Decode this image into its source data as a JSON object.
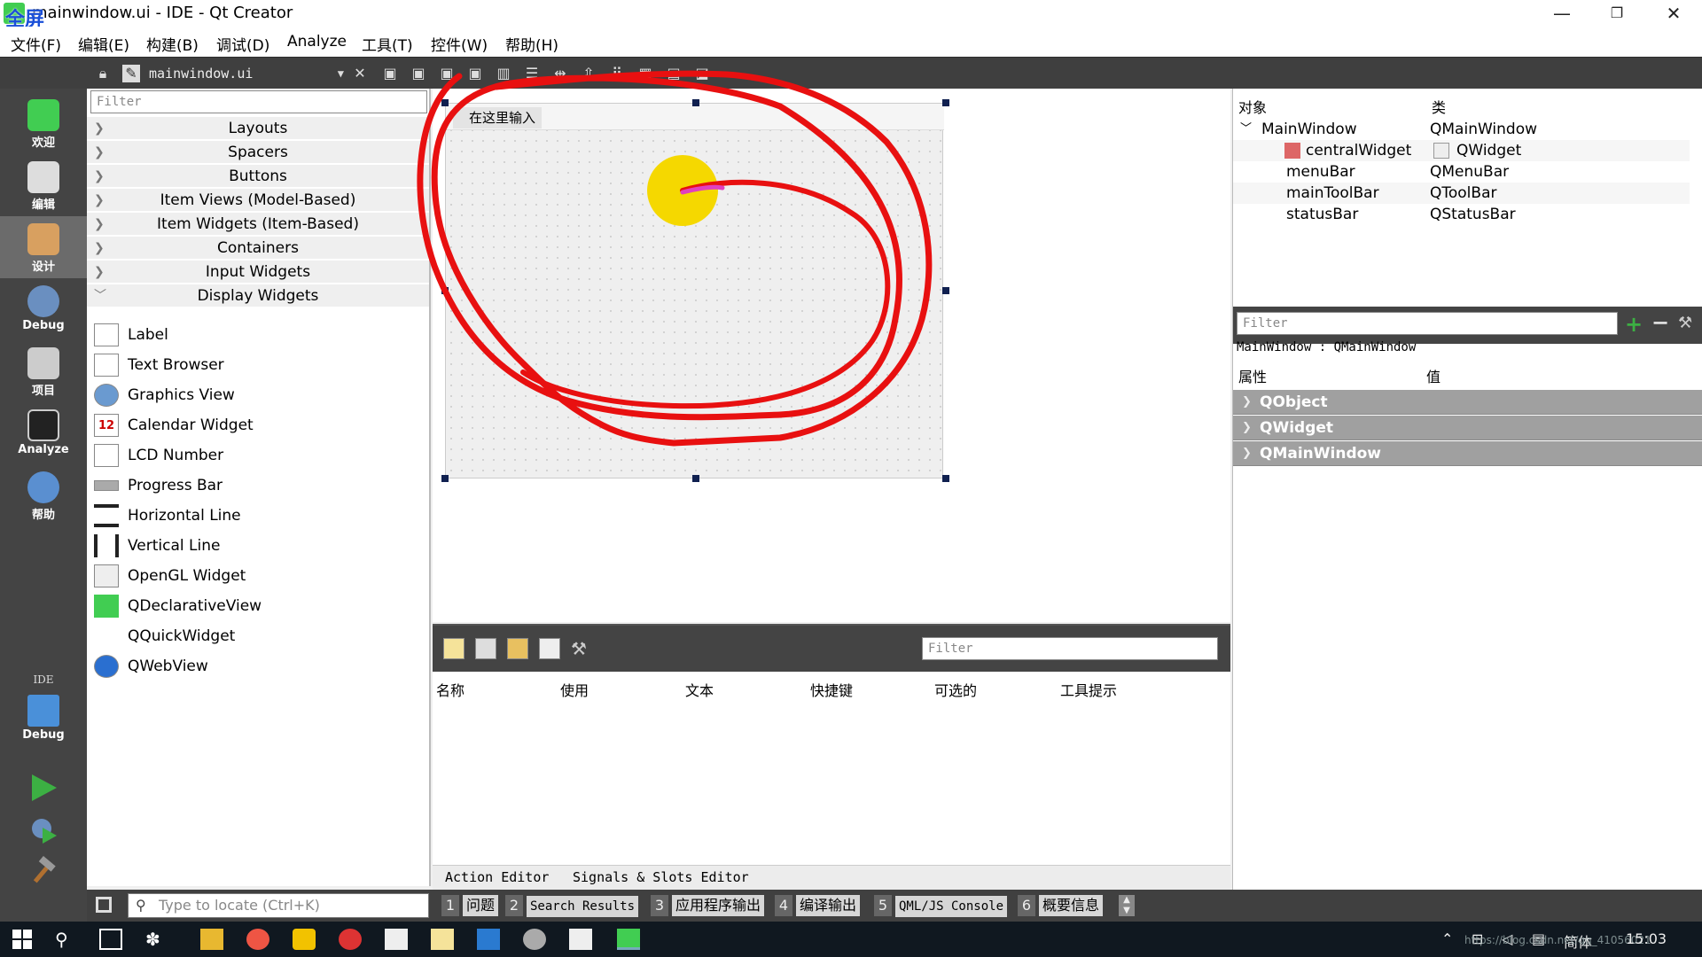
{
  "window": {
    "title": "mainwindow.ui - IDE - Qt Creator",
    "fullscreen_label": "全屏",
    "minimize": "—",
    "restore": "❐",
    "close": "✕"
  },
  "menubar": [
    "文件(F)",
    "编辑(E)",
    "构建(B)",
    "调试(D)",
    "Analyze",
    "工具(T)",
    "控件(W)",
    "帮助(H)"
  ],
  "toolbar": {
    "open_document": "mainwindow.ui"
  },
  "modes": [
    {
      "label": "欢迎",
      "color": "#41cd52"
    },
    {
      "label": "编辑",
      "color": "#dddddd"
    },
    {
      "label": "设计",
      "color": "#d8a060"
    },
    {
      "label": "Debug",
      "color": "#6a8fc0"
    },
    {
      "label": "项目",
      "color": "#cccccc"
    },
    {
      "label": "Analyze",
      "color": "#222222"
    },
    {
      "label": "帮助",
      "color": "#5a8fd0"
    }
  ],
  "kit_selector": {
    "label": "IDE",
    "mode": "Debug"
  },
  "widgetbox": {
    "filter_placeholder": "Filter",
    "categories": [
      "Layouts",
      "Spacers",
      "Buttons",
      "Item Views (Model-Based)",
      "Item Widgets (Item-Based)",
      "Containers",
      "Input Widgets",
      "Display Widgets"
    ],
    "display_widgets": [
      "Label",
      "Text Browser",
      "Graphics View",
      "Calendar Widget",
      "LCD Number",
      "Progress Bar",
      "Horizontal Line",
      "Vertical Line",
      "OpenGL Widget",
      "QDeclarativeView",
      "QQuickWidget",
      "QWebView"
    ],
    "calendar_icon_text": "12"
  },
  "form": {
    "menu_placeholder": "在这里输入"
  },
  "action_editor": {
    "filter_placeholder": "Filter",
    "columns": [
      "名称",
      "使用",
      "文本",
      "快捷键",
      "可选的",
      "工具提示"
    ],
    "tabs": [
      "Action Editor",
      "Signals & Slots Editor"
    ]
  },
  "object_inspector": {
    "headers": [
      "对象",
      "类"
    ],
    "rows": [
      {
        "name": "MainWindow",
        "class": "QMainWindow"
      },
      {
        "name": "centralWidget",
        "class": "QWidget"
      },
      {
        "name": "menuBar",
        "class": "QMenuBar"
      },
      {
        "name": "mainToolBar",
        "class": "QToolBar"
      },
      {
        "name": "statusBar",
        "class": "QStatusBar"
      }
    ]
  },
  "property_editor": {
    "filter_placeholder": "Filter",
    "current": "MainWindow : QMainWindow",
    "headers": [
      "属性",
      "值"
    ],
    "groups": [
      "QObject",
      "QWidget",
      "QMainWindow"
    ]
  },
  "outputbar": {
    "locate_placeholder": "Type to locate (Ctrl+K)",
    "panes": [
      {
        "num": "1",
        "label": "问题"
      },
      {
        "num": "2",
        "label": "Search Results"
      },
      {
        "num": "3",
        "label": "应用程序输出"
      },
      {
        "num": "4",
        "label": "编译输出"
      },
      {
        "num": "5",
        "label": "QML/JS Console"
      },
      {
        "num": "6",
        "label": "概要信息"
      }
    ]
  },
  "taskbar": {
    "tray_lang": "简体",
    "watermark": "https://blog.csdn.net/qq_41056021",
    "clock": "15:03"
  },
  "colors": {
    "annotation_red": "#e81010",
    "annotation_dot": "#f5d800",
    "annotation_magenta": "#e040c0"
  }
}
